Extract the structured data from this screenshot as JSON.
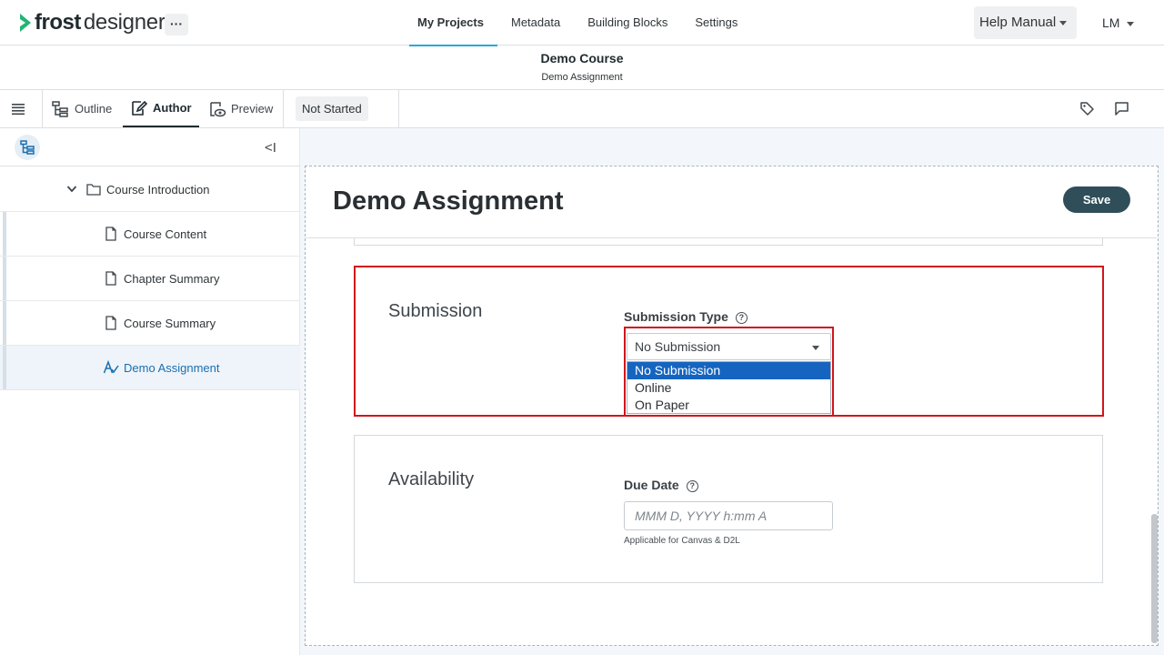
{
  "app": {
    "brand_part1": "frost",
    "brand_part2": "designer",
    "more_label": "···",
    "accent_color": "#29a8d9",
    "logo_color": "#21b573"
  },
  "nav": {
    "links": [
      "My Projects",
      "Metadata",
      "Building Blocks",
      "Settings"
    ],
    "active": "My Projects",
    "help_label": "Help Manual",
    "user_initials": "LM"
  },
  "course": {
    "title": "Demo Course",
    "subtitle": "Demo Assignment"
  },
  "toolbar": {
    "outline_label": "Outline",
    "author_label": "Author",
    "preview_label": "Preview",
    "status_label": "Not Started",
    "tag_icon": "tag-icon",
    "comment_icon": "comment-icon"
  },
  "sidebar": {
    "collapse_label": "<I",
    "folder": "Course Introduction",
    "items": [
      {
        "label": "Course Content",
        "icon": "page-icon"
      },
      {
        "label": "Chapter Summary",
        "icon": "page-icon"
      },
      {
        "label": "Course Summary",
        "icon": "page-icon"
      },
      {
        "label": "Demo Assignment",
        "icon": "assignment-icon",
        "selected": true
      }
    ]
  },
  "editor": {
    "title": "Demo Assignment",
    "save_label": "Save",
    "submission": {
      "section_title": "Submission",
      "field_label": "Submission Type",
      "help_glyph": "?",
      "selected_value": "No Submission",
      "options": [
        "No Submission",
        "Online",
        "On Paper"
      ]
    },
    "availability": {
      "section_title": "Availability",
      "field_label": "Due Date",
      "help_glyph": "?",
      "placeholder": "MMM D, YYYY h:mm A",
      "hint": "Applicable for Canvas & D2L"
    }
  }
}
